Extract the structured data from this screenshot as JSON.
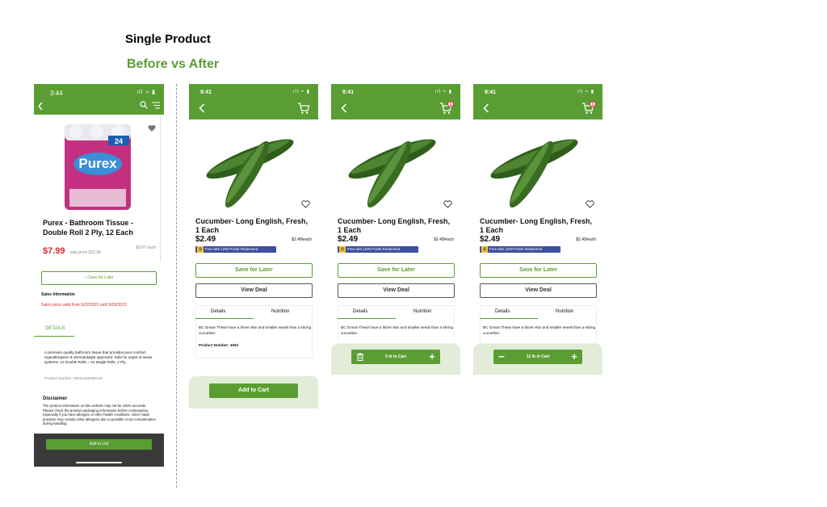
{
  "heading": "Single Product",
  "subheading": "Before vs After",
  "colors": {
    "brand_green": "#5a9e33",
    "sale_red": "#d42b2b",
    "promo_blue": "#3d4fa1",
    "bottom_panel": "#e3ecd9"
  },
  "before": {
    "status_time": "3:44",
    "status_icons": "ıll ≈ ▮",
    "icons": [
      "back-icon",
      "search-icon",
      "filter-icon",
      "heart-icon"
    ],
    "product_title": "Purex - Bathroom Tissue - Double Roll 2 Ply, 12 Each",
    "price": "$7.99",
    "was_price": "was price $10.99",
    "unit_price": "$0.67 each",
    "save_label": "Save for Later",
    "sales_info_label": "Sales Information",
    "sales_dates": "Sales price valid from 9/22/2022 until 9/28/2022",
    "details_tab": "DETAILS",
    "description": "A premium quality bathroom tissue that provides pure comfort. Hypoallergenic & dermatologist approved. Safe for septic & sewer systems. 12 Double Rolls = 24 Single Rolls. 2 Ply.",
    "product_number": "Product Number: 00061328482145",
    "disclaimer_title": "Disclaimer",
    "disclaimer": "The product information on this website may not be 100% accurate. Please check the product packaging information before consumption, especially if you have allergies or other health conditions. Store made products may contain other allergens due to possible cross contamination during handling.",
    "add_to_list_label": "Add to List"
  },
  "after": {
    "status_time": "9:41",
    "status_icons": "ıll ≈ ▮",
    "icons": [
      "back-icon",
      "cart-icon",
      "heart-icon",
      "trash-icon",
      "plus-icon",
      "minus-icon"
    ],
    "product_title": "Cucumber- Long English, Fresh, 1 Each",
    "price": "$2.49",
    "unit_price": "$2.49/each",
    "promo_logo": "Ⓢ",
    "promo_text": "Free with 1200 Points Redeemed",
    "save_label": "Save for Later",
    "deal_label": "View Deal",
    "tab_details": "Details",
    "tab_nutrition": "Nutrition",
    "description": "BC Grown These have a thiner skin and smaller seeds than a slicing cucumber.",
    "product_number": "Product Number: 4593",
    "add_to_cart_label": "Add to Cart",
    "cart_badge": "1",
    "cart_qty_b": "6 lb in Cart",
    "cart_qty_c": "12 lb in Cart",
    "plus": "+",
    "minus": "−"
  }
}
